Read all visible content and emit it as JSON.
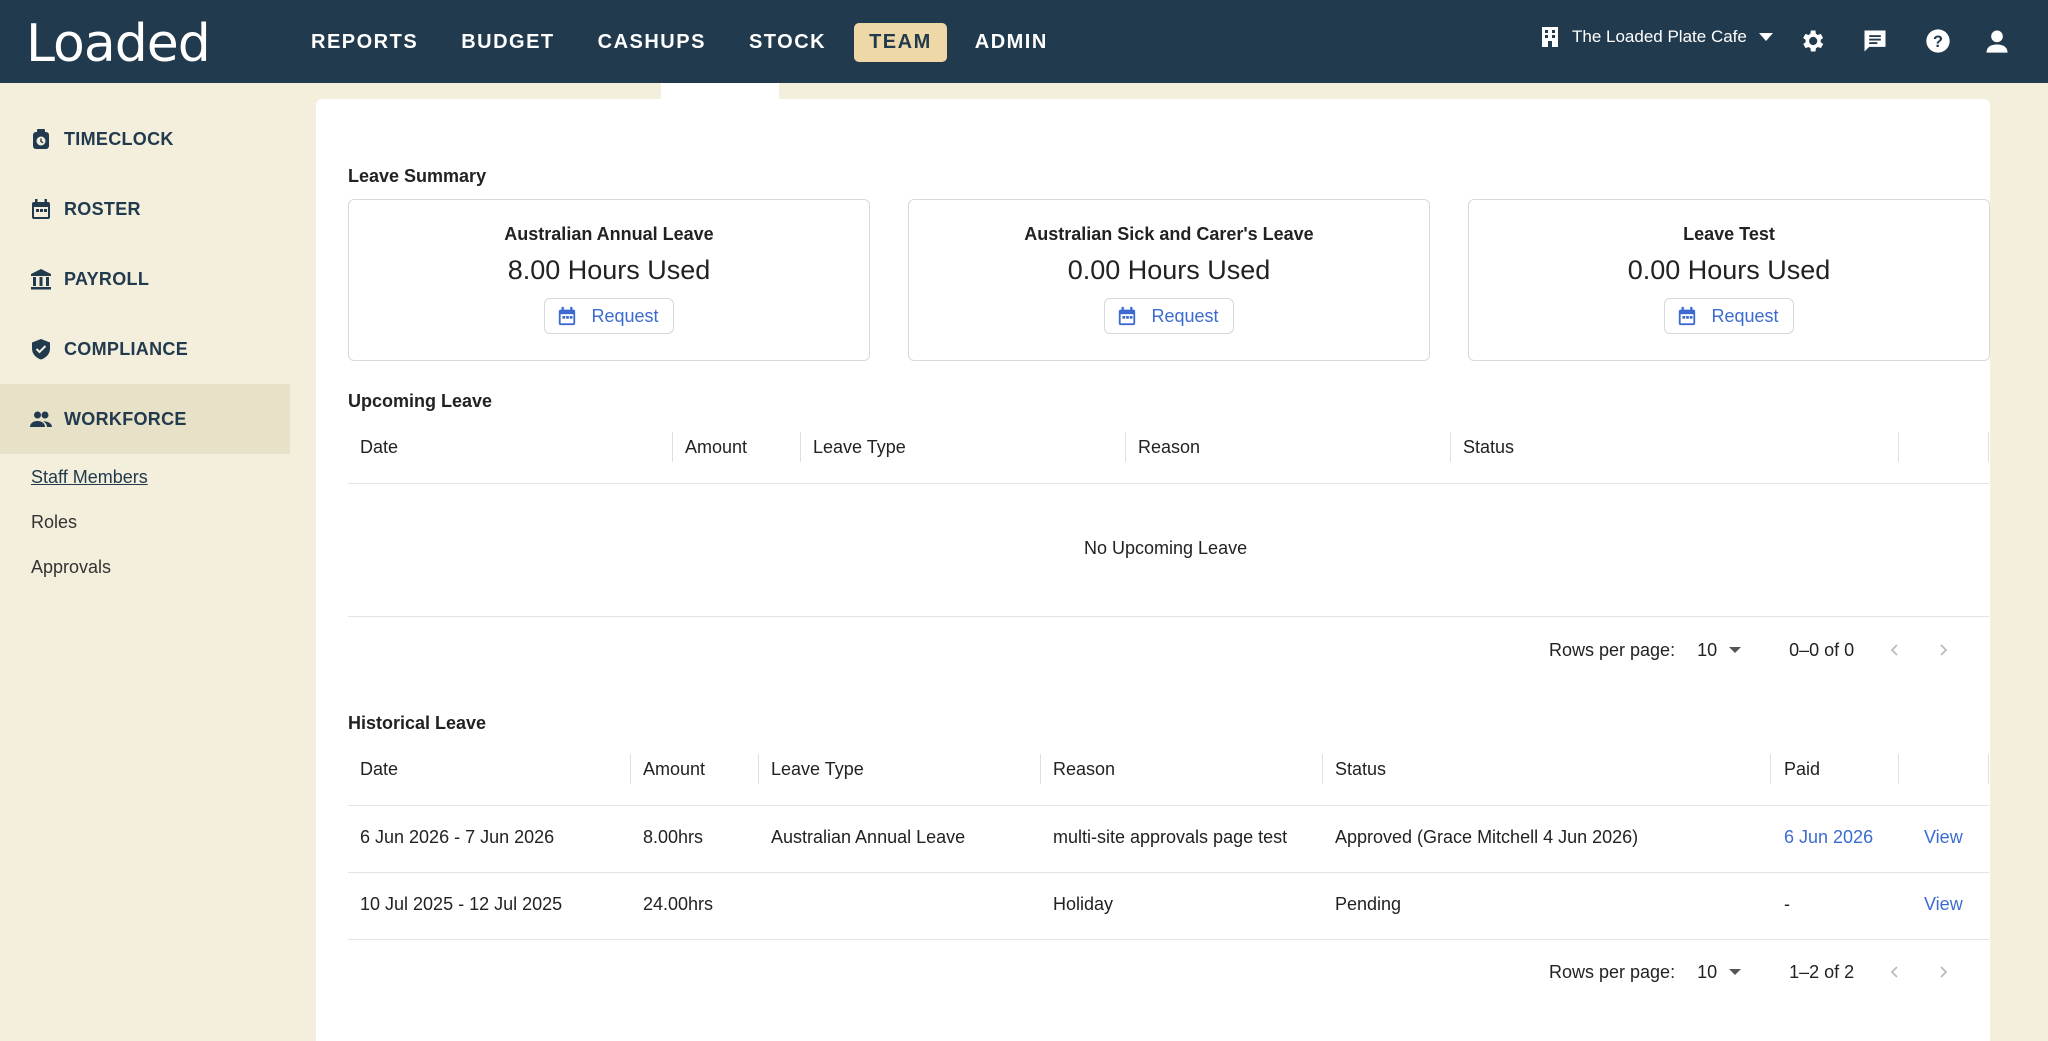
{
  "app": {
    "logo": "Loaded"
  },
  "nav": {
    "items": [
      "REPORTS",
      "BUDGET",
      "CASHUPS",
      "STOCK",
      "TEAM",
      "ADMIN"
    ],
    "active": "TEAM"
  },
  "venue": {
    "name": "The Loaded Plate Cafe"
  },
  "sidebar": {
    "items": [
      {
        "label": "TIMECLOCK",
        "icon": "timeclock-icon"
      },
      {
        "label": "ROSTER",
        "icon": "calendar-icon"
      },
      {
        "label": "PAYROLL",
        "icon": "bank-icon"
      },
      {
        "label": "COMPLIANCE",
        "icon": "shield-check-icon"
      },
      {
        "label": "WORKFORCE",
        "icon": "people-icon"
      }
    ],
    "sub_items": [
      "Staff Members",
      "Roles",
      "Approvals"
    ]
  },
  "leave_summary": {
    "title": "Leave Summary",
    "cards": [
      {
        "title": "Australian Annual Leave",
        "hours": "8.00 Hours Used",
        "button": "Request"
      },
      {
        "title": "Australian Sick and Carer's Leave",
        "hours": "0.00 Hours Used",
        "button": "Request"
      },
      {
        "title": "Leave Test",
        "hours": "0.00 Hours Used",
        "button": "Request"
      }
    ]
  },
  "upcoming": {
    "title": "Upcoming Leave",
    "columns": [
      "Date",
      "Amount",
      "Leave Type",
      "Reason",
      "Status"
    ],
    "empty": "No Upcoming Leave",
    "rows_per_page_label": "Rows per page:",
    "rows_per_page": "10",
    "range": "0–0 of 0"
  },
  "historical": {
    "title": "Historical Leave",
    "columns": [
      "Date",
      "Amount",
      "Leave Type",
      "Reason",
      "Status",
      "Paid"
    ],
    "rows": [
      {
        "date": "6 Jun 2026 - 7 Jun 2026",
        "amount": "8.00hrs",
        "type": "Australian Annual Leave",
        "reason": "multi-site approvals page test",
        "status": "Approved (Grace Mitchell 4 Jun 2026)",
        "paid": "6 Jun 2026",
        "action": "View"
      },
      {
        "date": "10 Jul 2025 - 12 Jul 2025",
        "amount": "24.00hrs",
        "type": "",
        "reason": "Holiday",
        "status": "Pending",
        "paid": "-",
        "action": "View"
      }
    ],
    "rows_per_page_label": "Rows per page:",
    "rows_per_page": "10",
    "range": "1–2 of 2"
  },
  "colors": {
    "topbar": "#223a4d",
    "active_nav": "#efd8a8",
    "sidebar_bg": "#f3efdc",
    "link": "#3c6bd0"
  }
}
